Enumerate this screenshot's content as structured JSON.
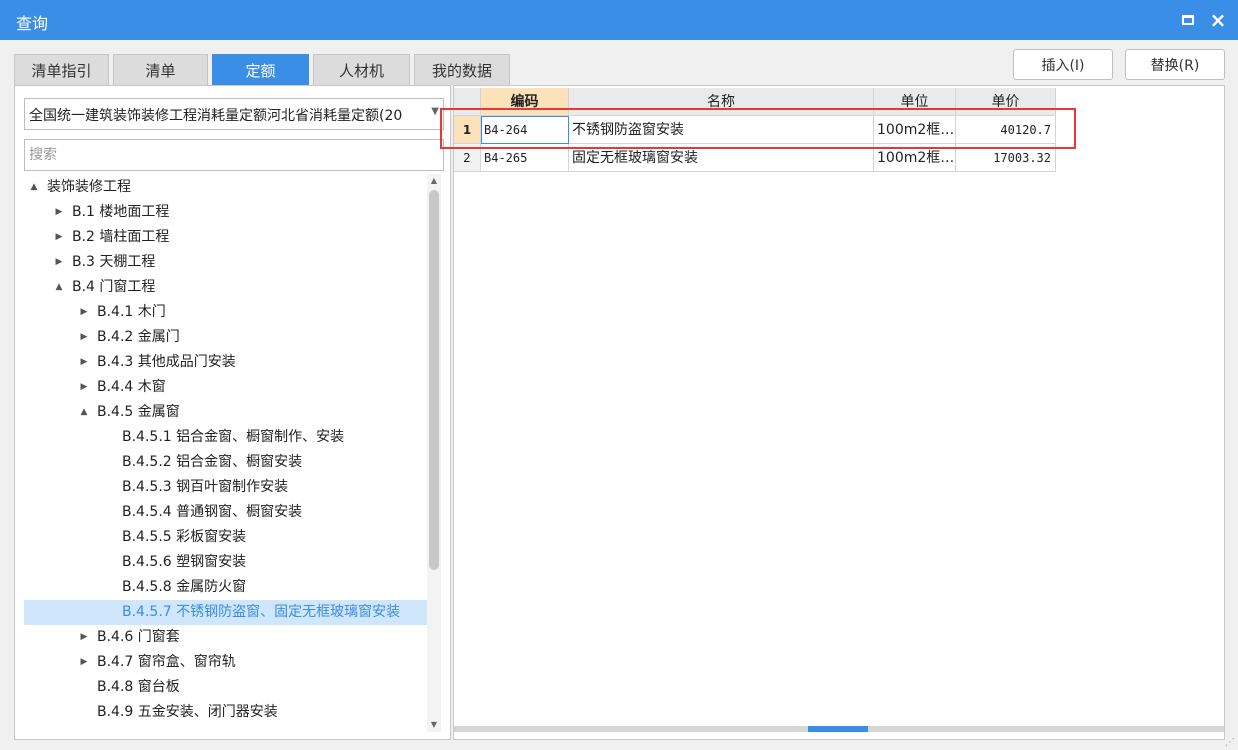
{
  "window": {
    "title": "查询"
  },
  "tabs": [
    {
      "label": "清单指引"
    },
    {
      "label": "清单"
    },
    {
      "label": "定额"
    },
    {
      "label": "人材机"
    },
    {
      "label": "我的数据"
    }
  ],
  "actions": {
    "insert_label": "插入(I)",
    "replace_label": "替换(R)"
  },
  "library_select": {
    "value": "全国统一建筑装饰装修工程消耗量定额河北省消耗量定额(20"
  },
  "search": {
    "placeholder": "搜索",
    "value": ""
  },
  "tree": [
    {
      "label": "装饰装修工程",
      "arrow": "▲"
    },
    {
      "label": "B.1 楼地面工程",
      "arrow": "▶"
    },
    {
      "label": "B.2 墙柱面工程",
      "arrow": "▶"
    },
    {
      "label": "B.3 天棚工程",
      "arrow": "▶"
    },
    {
      "label": "B.4 门窗工程",
      "arrow": "▲"
    },
    {
      "label": "B.4.1 木门",
      "arrow": "▶"
    },
    {
      "label": "B.4.2 金属门",
      "arrow": "▶"
    },
    {
      "label": "B.4.3 其他成品门安装",
      "arrow": "▶"
    },
    {
      "label": "B.4.4 木窗",
      "arrow": "▶"
    },
    {
      "label": "B.4.5 金属窗",
      "arrow": "▲"
    },
    {
      "label": "B.4.5.1 铝合金窗、橱窗制作、安装",
      "arrow": ""
    },
    {
      "label": "B.4.5.2 铝合金窗、橱窗安装",
      "arrow": ""
    },
    {
      "label": "B.4.5.3 钢百叶窗制作安装",
      "arrow": ""
    },
    {
      "label": "B.4.5.4 普通钢窗、橱窗安装",
      "arrow": ""
    },
    {
      "label": "B.4.5.5 彩板窗安装",
      "arrow": ""
    },
    {
      "label": "B.4.5.6 塑钢窗安装",
      "arrow": ""
    },
    {
      "label": "B.4.5.8 金属防火窗",
      "arrow": ""
    },
    {
      "label": "B.4.5.7 不锈钢防盗窗、固定无框玻璃窗安装",
      "arrow": ""
    },
    {
      "label": "B.4.6 门窗套",
      "arrow": "▶"
    },
    {
      "label": "B.4.7 窗帘盒、窗帘轨",
      "arrow": "▶"
    },
    {
      "label": "B.4.8 窗台板",
      "arrow": ""
    },
    {
      "label": "B.4.9 五金安装、闭门器安装",
      "arrow": ""
    }
  ],
  "table": {
    "headers": [
      "编码",
      "名称",
      "单位",
      "单价"
    ],
    "rows": [
      {
        "num": "1",
        "code": "B4-264",
        "name": "不锈钢防盗窗安装",
        "unit": "100m2框…",
        "price": "40120.7"
      },
      {
        "num": "2",
        "code": "B4-265",
        "name": "固定无框玻璃窗安装",
        "unit": "100m2框…",
        "price": "17003.32"
      }
    ]
  },
  "colors": {
    "accent": "#3b8ee6",
    "highlight": "#e53935",
    "code_header": "#fbe2bb"
  }
}
